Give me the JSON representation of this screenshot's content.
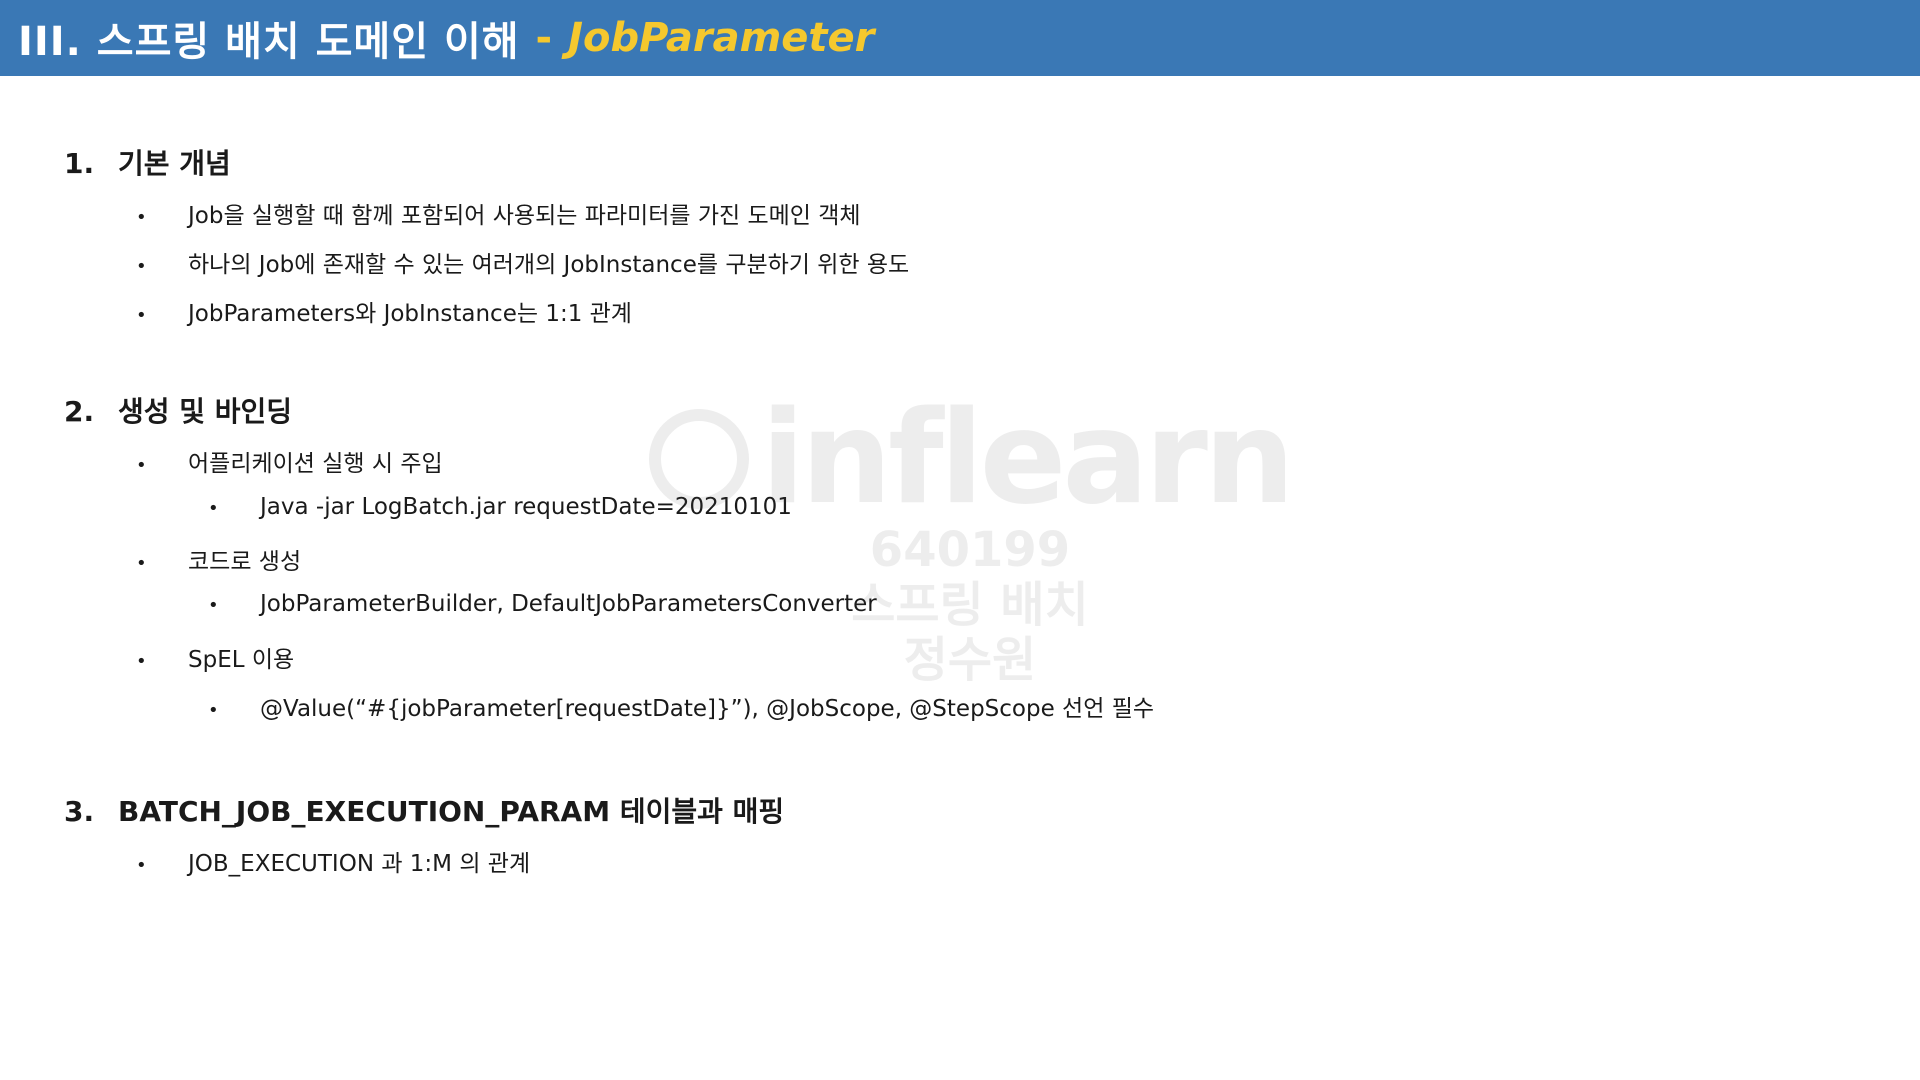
{
  "header": {
    "title": "III. 스프링 배치 도메인 이해",
    "separator": "-",
    "subtitle": "JobParameter"
  },
  "sections": [
    {
      "number": "1.",
      "title": "기본 개념",
      "items": [
        "Job을 실행할 때 함께 포함되어 사용되는 파라미터를 가진 도메인 객체",
        "하나의 Job에 존재할 수 있는 여러개의 JobInstance를 구분하기 위한 용도",
        "JobParameters와 JobInstance는 1:1 관계"
      ]
    },
    {
      "number": "2.",
      "title": "생성 및 바인딩",
      "items": [
        {
          "text": "어플리케이션 실행 시 주입",
          "sub": "Java -jar LogBatch.jar requestDate=20210101"
        },
        {
          "text": "코드로 생성",
          "sub": "JobParameterBuilder, DefaultJobParametersConverter"
        },
        {
          "text": "SpEL 이용",
          "sub": "@Value(“#{jobParameter[requestDate]}”), @JobScope, @StepScope 선언 필수"
        }
      ]
    },
    {
      "number": "3.",
      "title": "BATCH_JOB_EXECUTION_PARAM 테이블과 매핑",
      "items": [
        "JOB_EXECUTION 과 1:M 의 관계"
      ]
    }
  ],
  "bullet": "•",
  "watermark": {
    "logo": "inflearn",
    "lines": [
      "640199",
      "스프링 배치",
      "정수원"
    ]
  },
  "colors": {
    "header_bg": "#3a78b5",
    "header_text": "#ffffff",
    "accent": "#f5c82e"
  }
}
